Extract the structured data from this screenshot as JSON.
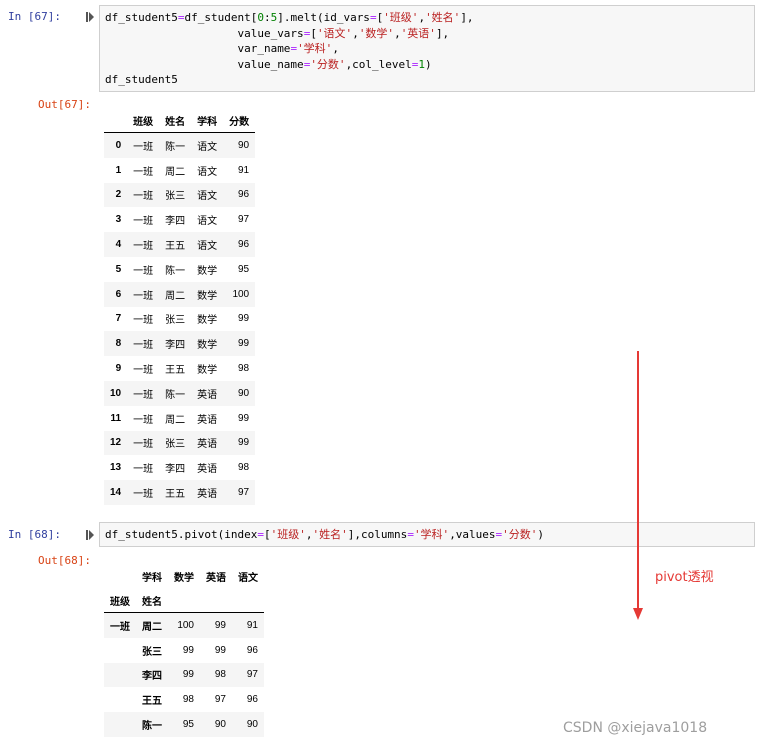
{
  "cell1": {
    "in_prompt": "In  [67]:",
    "out_prompt": "Out[67]:",
    "code": {
      "l1a": "df_student5",
      "l1b": "=",
      "l1c": "df_student[",
      "l1d": "0",
      "l1e": ":",
      "l1f": "5",
      "l1g": "].melt(id_vars",
      "l1h": "=",
      "l1i": "[",
      "l1j": "'班级'",
      "l1k": ",",
      "l1l": "'姓名'",
      "l1m": "],",
      "l2a": "value_vars",
      "l2b": "=",
      "l2c": "[",
      "l2d": "'语文'",
      "l2e": ",",
      "l2f": "'数学'",
      "l2g": ",",
      "l2h": "'英语'",
      "l2i": "],",
      "l3a": "var_name",
      "l3b": "=",
      "l3c": "'学科'",
      "l3d": ",",
      "l4a": "value_name",
      "l4b": "=",
      "l4c": "'分数'",
      "l4d": ",col_level",
      "l4e": "=",
      "l4f": "1",
      "l4g": ")",
      "l5": "df_student5"
    },
    "table": {
      "headers": [
        "",
        "班级",
        "姓名",
        "学科",
        "分数"
      ],
      "rows": [
        [
          "0",
          "一班",
          "陈一",
          "语文",
          "90"
        ],
        [
          "1",
          "一班",
          "周二",
          "语文",
          "91"
        ],
        [
          "2",
          "一班",
          "张三",
          "语文",
          "96"
        ],
        [
          "3",
          "一班",
          "李四",
          "语文",
          "97"
        ],
        [
          "4",
          "一班",
          "王五",
          "语文",
          "96"
        ],
        [
          "5",
          "一班",
          "陈一",
          "数学",
          "95"
        ],
        [
          "6",
          "一班",
          "周二",
          "数学",
          "100"
        ],
        [
          "7",
          "一班",
          "张三",
          "数学",
          "99"
        ],
        [
          "8",
          "一班",
          "李四",
          "数学",
          "99"
        ],
        [
          "9",
          "一班",
          "王五",
          "数学",
          "98"
        ],
        [
          "10",
          "一班",
          "陈一",
          "英语",
          "90"
        ],
        [
          "11",
          "一班",
          "周二",
          "英语",
          "99"
        ],
        [
          "12",
          "一班",
          "张三",
          "英语",
          "99"
        ],
        [
          "13",
          "一班",
          "李四",
          "英语",
          "98"
        ],
        [
          "14",
          "一班",
          "王五",
          "英语",
          "97"
        ]
      ]
    }
  },
  "cell2": {
    "in_prompt": "In  [68]:",
    "out_prompt": "Out[68]:",
    "code": {
      "a": "df_student5.pivot(index",
      "b": "=",
      "c": "[",
      "d": "'班级'",
      "e": ",",
      "f": "'姓名'",
      "g": "],columns",
      "h": "=",
      "i": "'学科'",
      "j": ",values",
      "k": "=",
      "l": "'分数'",
      "m": ")"
    },
    "table": {
      "columns_name": "学科",
      "columns": [
        "数学",
        "英语",
        "语文"
      ],
      "index_names": [
        "班级",
        "姓名"
      ],
      "group": "一班",
      "rows": [
        {
          "name": "周二",
          "values": [
            "100",
            "99",
            "91"
          ]
        },
        {
          "name": "张三",
          "values": [
            "99",
            "99",
            "96"
          ]
        },
        {
          "name": "李四",
          "values": [
            "99",
            "98",
            "97"
          ]
        },
        {
          "name": "王五",
          "values": [
            "98",
            "97",
            "96"
          ]
        },
        {
          "name": "陈一",
          "values": [
            "95",
            "90",
            "90"
          ]
        }
      ]
    }
  },
  "annotation": "pivot透视",
  "watermark": "CSDN @xiejava1018",
  "colors": {
    "arrow": "#e53935",
    "in_prompt": "#303f9f",
    "out_prompt": "#d84315"
  }
}
